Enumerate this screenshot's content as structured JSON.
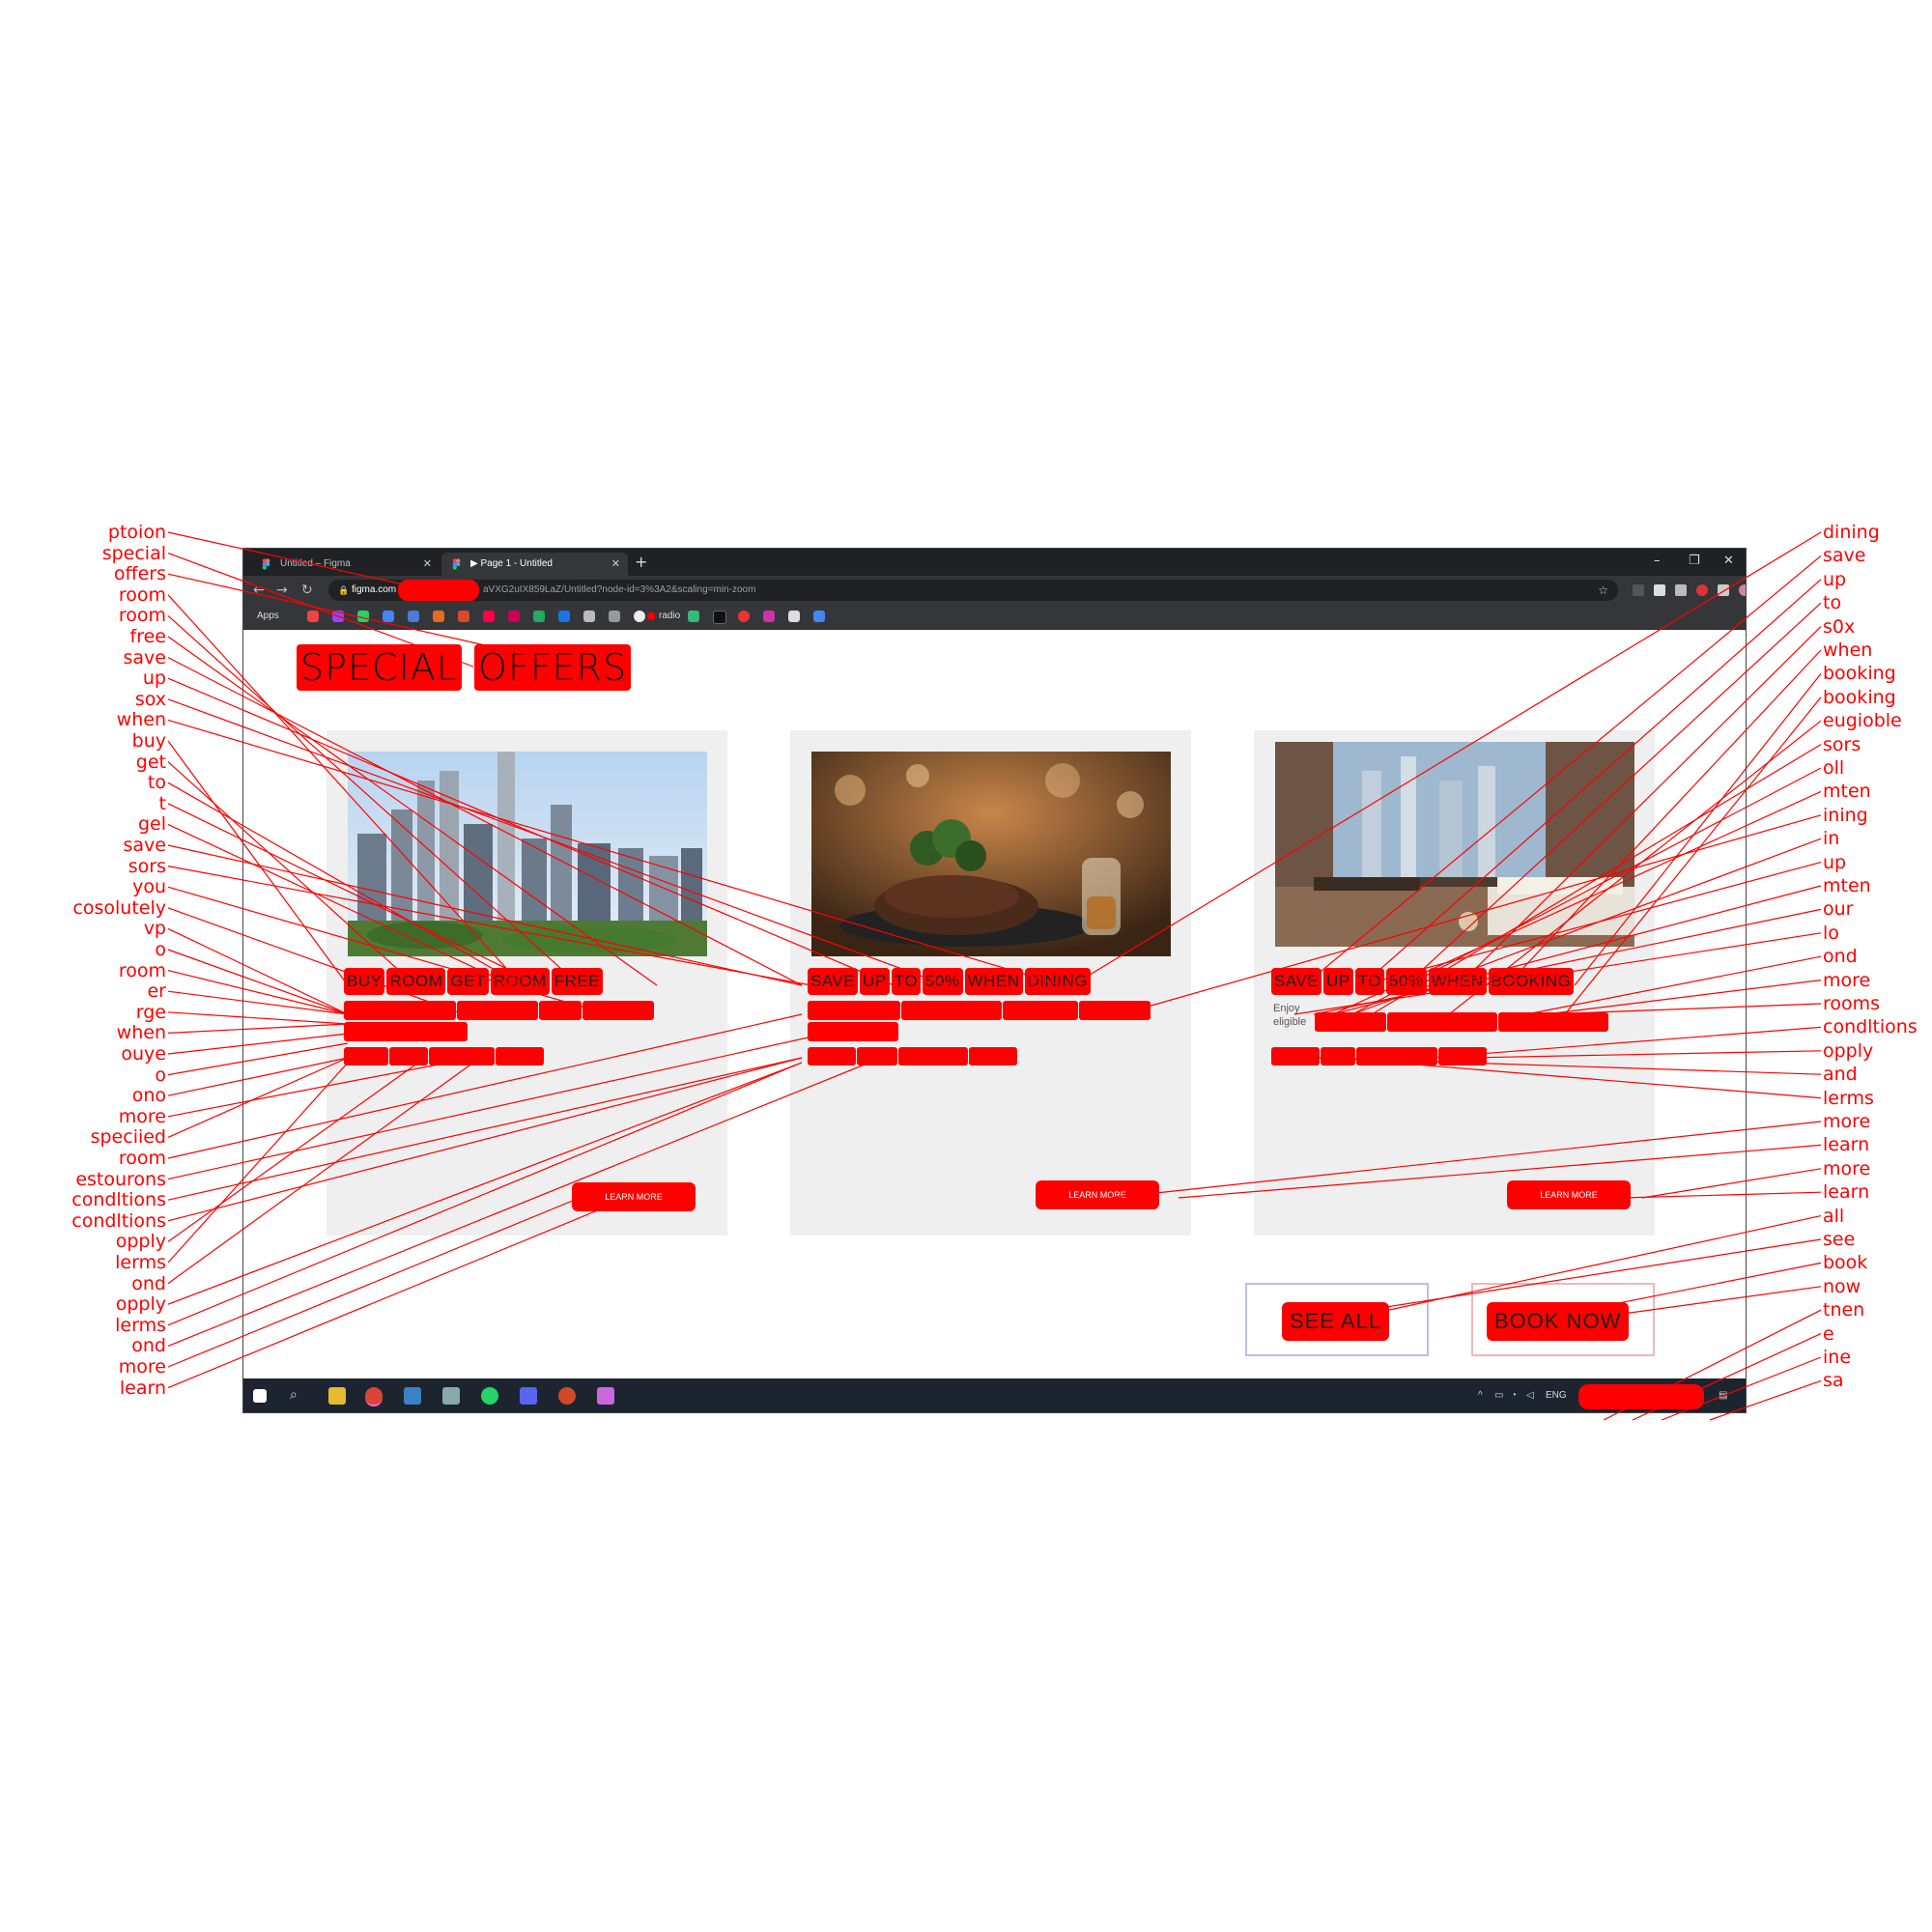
{
  "browser": {
    "tabs": [
      {
        "label": "Untitled – Figma",
        "active": false
      },
      {
        "label": "▶ Page 1 - Untitled",
        "active": true
      }
    ],
    "new_tab": "+",
    "window_controls": {
      "minimize": "–",
      "restore": "❐",
      "close": "✕"
    },
    "url": {
      "host": "figma.com",
      "path": "aVXG2uIX859LaZ/Untitled?node-id=3%3A2&scaling=min-zoom"
    },
    "bookmarks": {
      "apps_label": "Apps",
      "radio_label": "radio"
    }
  },
  "page": {
    "title_words": [
      "SPECIAL",
      "OFFERS"
    ],
    "cards": [
      {
        "title_words": [
          "BUY",
          "ROOM",
          "GET",
          "ROOM",
          "FREE"
        ],
        "learn_more": "LEARN MORE",
        "image": "city-skyline"
      },
      {
        "title_words": [
          "SAVE",
          "UP",
          "TO",
          "50%",
          "WHEN",
          "DINING"
        ],
        "learn_more": "LEARN MORE",
        "image": "steak-dinner"
      },
      {
        "title_words": [
          "SAVE",
          "UP",
          "TO",
          "50%",
          "WHEN",
          "BOOKING"
        ],
        "description_visible": "Enjoy eligible",
        "learn_more": "LEARN MORE",
        "image": "hotel-room"
      }
    ],
    "buttons": {
      "see_all": "SEE ALL",
      "book_now": "BOOK NOW"
    }
  },
  "taskbar": {
    "language": "ENG"
  },
  "annotations": {
    "left": [
      "ptoion",
      "special",
      "offers",
      "room",
      "room",
      "free",
      "save",
      "up",
      "sox",
      "when",
      "buy",
      "get",
      "to",
      "t",
      "gel",
      "save",
      "sors",
      "you",
      "cosolutely",
      "vp",
      "o",
      "room",
      "er",
      "rge",
      "when",
      "ouye",
      "o",
      "ono",
      "more",
      "speciied",
      "room",
      "estourons",
      "condltions",
      "condltions",
      "opply",
      "lerms",
      "ond",
      "opply",
      "lerms",
      "ond",
      "more",
      "learn"
    ],
    "right": [
      "dining",
      "save",
      "up",
      "to",
      "s0x",
      "when",
      "booking",
      "booking",
      "eugioble",
      "sors",
      "oll",
      "mten",
      "ining",
      "in",
      "up",
      "mten",
      "our",
      "lo",
      "ond",
      "more",
      "rooms",
      "condltions",
      "opply",
      "and",
      "lerms",
      "more",
      "learn",
      "more",
      "learn",
      "all",
      "see",
      "book",
      "now",
      "tnen",
      "e",
      "ine",
      "sa"
    ]
  },
  "colors": {
    "highlight": "#ff0000",
    "card_bg": "#efefef",
    "chrome_dark": "#202124",
    "taskbar": "#1c2430"
  }
}
